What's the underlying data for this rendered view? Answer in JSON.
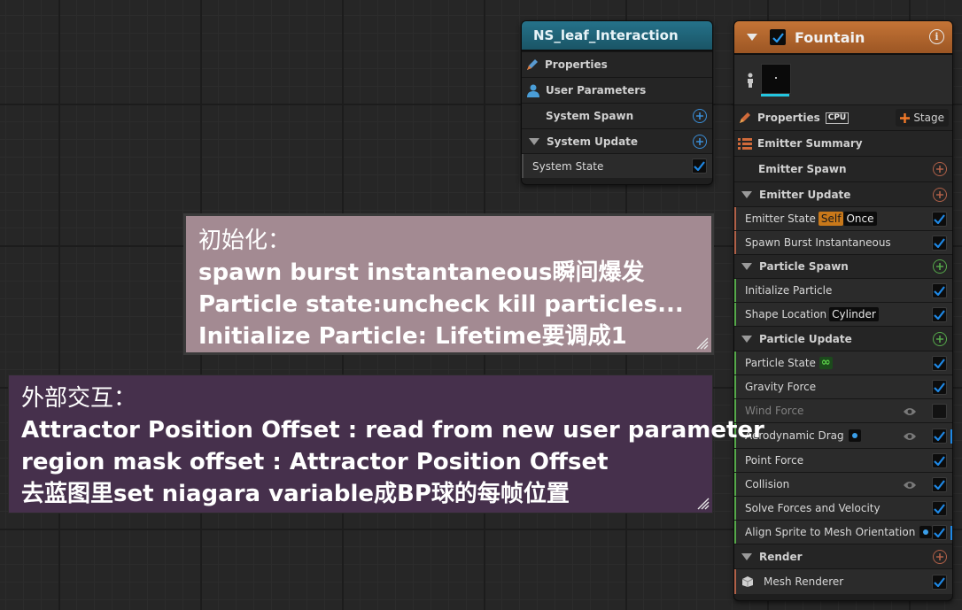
{
  "system_node": {
    "title": "NS_leaf_Interaction",
    "rows": {
      "properties": "Properties",
      "user_parameters": "User Parameters",
      "system_spawn": "System Spawn",
      "system_update": "System Update",
      "system_state": "System State"
    }
  },
  "emitter_node": {
    "title": "Fountain",
    "properties": "Properties",
    "cpu_badge": "CPU",
    "stage_button": "Stage",
    "emitter_summary": "Emitter Summary",
    "emitter_spawn": "Emitter Spawn",
    "emitter_update": "Emitter Update",
    "emitter_state": "Emitter State",
    "emitter_state_self": "Self",
    "emitter_state_once": "Once",
    "spawn_burst": "Spawn Burst Instantaneous",
    "particle_spawn": "Particle Spawn",
    "initialize_particle": "Initialize Particle",
    "shape_location": "Shape Location",
    "shape_location_value": "Cylinder",
    "particle_update": "Particle Update",
    "particle_state": "Particle State",
    "particle_state_badge": "∞",
    "gravity_force": "Gravity Force",
    "wind_force": "Wind Force",
    "aerodynamic_drag": "Aerodynamic Drag",
    "point_force": "Point Force",
    "collision": "Collision",
    "solve_forces": "Solve Forces and Velocity",
    "align_sprite": "Align Sprite to Mesh Orientation",
    "render": "Render",
    "mesh_renderer": "Mesh Renderer"
  },
  "comment_init": {
    "lines": [
      "初始化：",
      "spawn burst  instantaneous瞬间爆发",
      "Particle state:uncheck kill particles...",
      "Initialize Particle: Lifetime要调成1"
    ]
  },
  "comment_interaction": {
    "lines": [
      "外部交互：",
      "Attractor Position Offset : read from new user parameter",
      "region mask offset : Attractor Position Offset",
      "去蓝图里set niagara variable成BP球的每帧位置"
    ]
  },
  "colors": {
    "graph_bg": "#262626",
    "accent_blue": "#1a7fd6",
    "emitter_header": "#b8662a",
    "system_header": "#1d6a80",
    "comment_init_bg": "#a38a92",
    "comment_interaction_bg": "#46304c"
  }
}
